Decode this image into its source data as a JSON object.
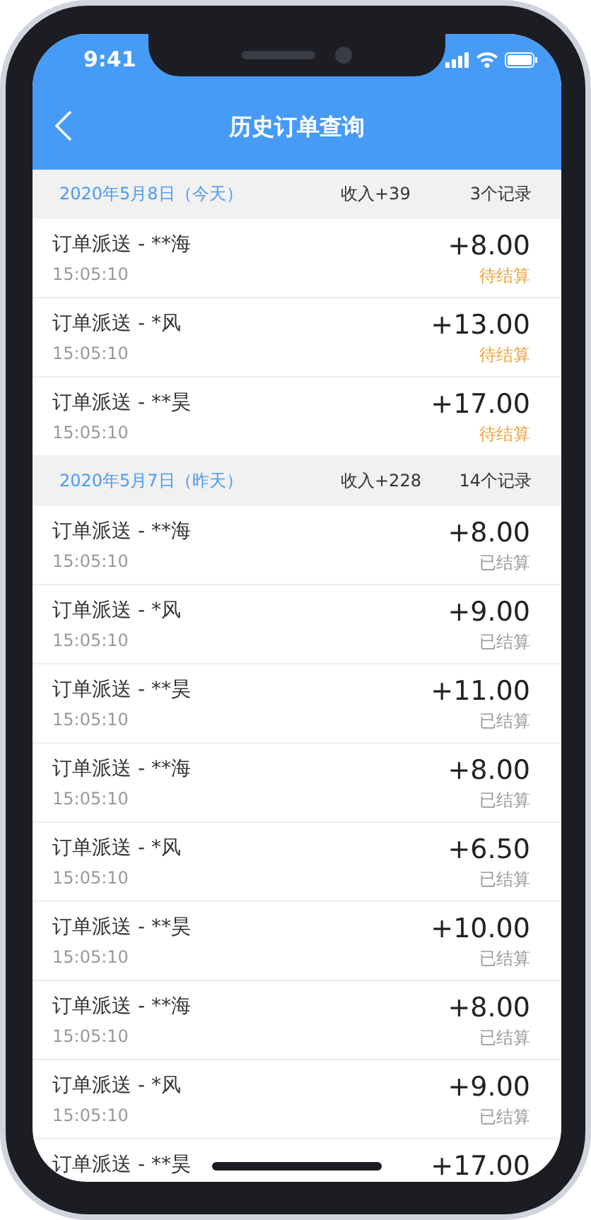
{
  "status_bar": {
    "time": "9:41"
  },
  "header": {
    "title": "历史订单查询"
  },
  "groups": [
    {
      "date": "2020年5月8日（今天）",
      "income": "收入+39",
      "count": "3个记录",
      "orders": [
        {
          "name": "订单派送 - **海",
          "time": "15:05:10",
          "amount": "+8.00",
          "status": "待结算",
          "settled": false
        },
        {
          "name": "订单派送 - *风",
          "time": "15:05:10",
          "amount": "+13.00",
          "status": "待结算",
          "settled": false
        },
        {
          "name": "订单派送 - **昊",
          "time": "15:05:10",
          "amount": "+17.00",
          "status": "待结算",
          "settled": false
        }
      ]
    },
    {
      "date": "2020年5月7日（昨天）",
      "income": "收入+228",
      "count": "14个记录",
      "orders": [
        {
          "name": "订单派送 - **海",
          "time": "15:05:10",
          "amount": "+8.00",
          "status": "已结算",
          "settled": true
        },
        {
          "name": "订单派送 - *风",
          "time": "15:05:10",
          "amount": "+9.00",
          "status": "已结算",
          "settled": true
        },
        {
          "name": "订单派送 - **昊",
          "time": "15:05:10",
          "amount": "+11.00",
          "status": "已结算",
          "settled": true
        },
        {
          "name": "订单派送 - **海",
          "time": "15:05:10",
          "amount": "+8.00",
          "status": "已结算",
          "settled": true
        },
        {
          "name": "订单派送 - *风",
          "time": "15:05:10",
          "amount": "+6.50",
          "status": "已结算",
          "settled": true
        },
        {
          "name": "订单派送 - **昊",
          "time": "15:05:10",
          "amount": "+10.00",
          "status": "已结算",
          "settled": true
        },
        {
          "name": "订单派送 - **海",
          "time": "15:05:10",
          "amount": "+8.00",
          "status": "已结算",
          "settled": true
        },
        {
          "name": "订单派送 - *风",
          "time": "15:05:10",
          "amount": "+9.00",
          "status": "已结算",
          "settled": true
        },
        {
          "name": "订单派送 - **昊",
          "amount": "+17.00"
        }
      ]
    }
  ]
}
